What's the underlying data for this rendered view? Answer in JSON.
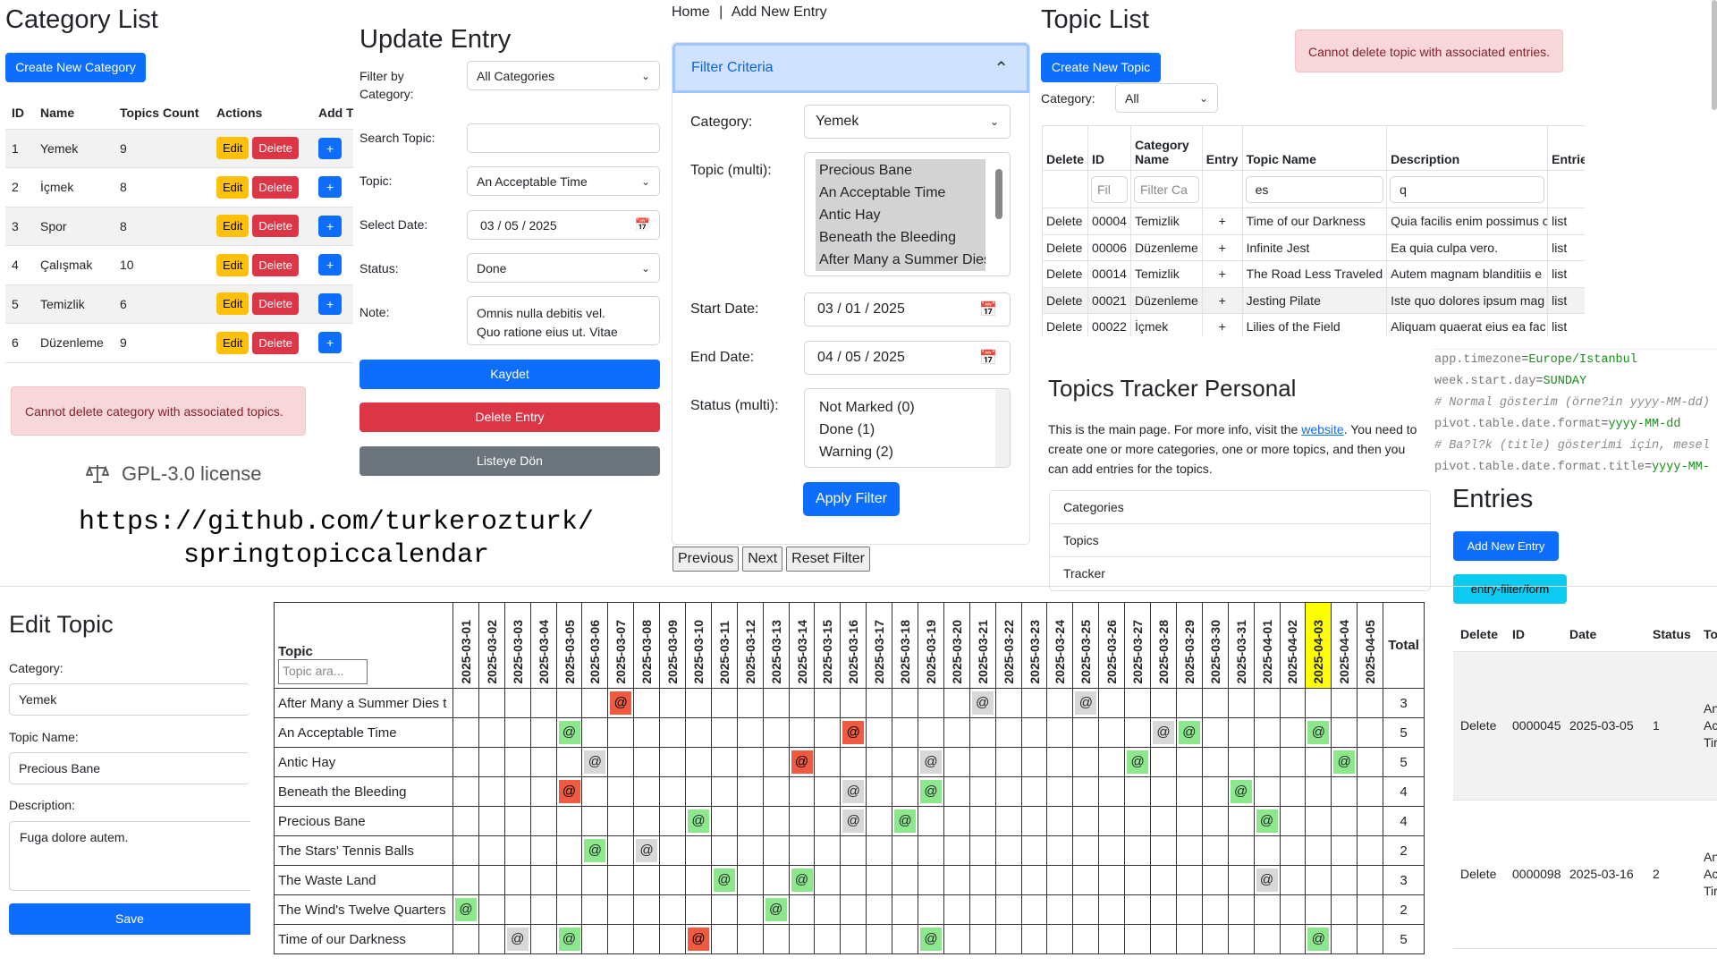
{
  "category_list": {
    "title": "Category List",
    "create_btn": "Create New Category",
    "headers": [
      "ID",
      "Name",
      "Topics Count",
      "Actions",
      "Add T"
    ],
    "rows": [
      {
        "id": "1",
        "name": "Yemek",
        "count": "9"
      },
      {
        "id": "2",
        "name": "İçmek",
        "count": "8"
      },
      {
        "id": "3",
        "name": "Spor",
        "count": "8"
      },
      {
        "id": "4",
        "name": "Çalışmak",
        "count": "10"
      },
      {
        "id": "5",
        "name": "Temizlik",
        "count": "6"
      },
      {
        "id": "6",
        "name": "Düzenleme",
        "count": "9"
      }
    ],
    "edit_label": "Edit",
    "delete_label": "Delete",
    "add_label": "+",
    "alert": "Cannot delete category with associated topics."
  },
  "license": {
    "icon": "scale-icon",
    "text": "GPL-3.0 license"
  },
  "repo_url_line1": "https://github.com/turkerozturk/",
  "repo_url_line2": "springtopiccalendar",
  "update_entry": {
    "title": "Update Entry",
    "filter_label": "Filter by Category:",
    "filter_value": "All Categories",
    "search_label": "Search Topic:",
    "search_value": "",
    "topic_label": "Topic:",
    "topic_value": "An Acceptable Time",
    "date_label": "Select Date:",
    "date_value": "03 / 05 / 2025",
    "status_label": "Status:",
    "status_value": "Done",
    "note_label": "Note:",
    "note_line1": "Omnis nulla debitis vel.",
    "note_line2": "Quo ratione eius ut. Vitae",
    "save_btn": "Kaydet",
    "delete_btn": "Delete Entry",
    "back_btn": "Listeye Dön"
  },
  "breadcrumb": {
    "home": "Home",
    "sep": "|",
    "current": "Add New Entry"
  },
  "filter": {
    "header": "Filter Criteria",
    "category_label": "Category:",
    "category_value": "Yemek",
    "topic_label": "Topic (multi):",
    "topics": [
      "Precious Bane",
      "An Acceptable Time",
      "Antic Hay",
      "Beneath the Bleeding",
      "After Many a Summer Dies t"
    ],
    "start_label": "Start Date:",
    "start_value": "03 / 01 / 2025",
    "end_label": "End Date:",
    "end_value": "04 / 05 / 2025",
    "status_label": "Status (multi):",
    "statuses": [
      "Not Marked (0)",
      "Done (1)",
      "Warning (2)"
    ],
    "apply_btn": "Apply Filter",
    "prev_btn": "Previous",
    "next_btn": "Next",
    "reset_btn": "Reset Filter"
  },
  "topic_list": {
    "title": "Topic List",
    "create_btn": "Create New Topic",
    "alert": "Cannot delete topic with associated entries.",
    "category_label": "Category:",
    "category_value": "All",
    "headers": [
      "Delete",
      "ID",
      "Category Name",
      "Entry",
      "Topic Name",
      "Description",
      "Entries"
    ],
    "filter_id": "Fil",
    "filter_cat": "Filter Ca",
    "filter_name": "es",
    "filter_desc": "q",
    "rows": [
      {
        "del": "Delete",
        "id": "00004",
        "cat": "Temizlik",
        "entry": "+",
        "name": "Time of our Darkness",
        "desc": "Quia facilis enim possimus c",
        "entries": "list"
      },
      {
        "del": "Delete",
        "id": "00006",
        "cat": "Düzenleme",
        "entry": "+",
        "name": "Infinite Jest",
        "desc": "Ea quia culpa vero.",
        "entries": "list"
      },
      {
        "del": "Delete",
        "id": "00014",
        "cat": "Temizlik",
        "entry": "+",
        "name": "The Road Less Traveled",
        "desc": "Autem magnam blanditiis e",
        "entries": "list"
      },
      {
        "del": "Delete",
        "id": "00021",
        "cat": "Düzenleme",
        "entry": "+",
        "name": "Jesting Pilate",
        "desc": "Iste quo dolores ipsum mag",
        "entries": "list"
      },
      {
        "del": "Delete",
        "id": "00022",
        "cat": "İçmek",
        "entry": "+",
        "name": "Lilies of the Field",
        "desc": "Aliquam quaerat eius ea fac",
        "entries": "list"
      }
    ]
  },
  "tracker": {
    "title": "Topics Tracker Personal",
    "text_before": "This is the main page. For more info, visit the ",
    "link": "website",
    "text_after": ". You need to create one or more categories, one or more topics, and then you can add entries for the topics.",
    "items": [
      "Categories",
      "Topics",
      "Tracker"
    ]
  },
  "config": [
    {
      "key": "app.timezone",
      "value": "Europe/Istanbul"
    },
    {
      "key": "week.start.day",
      "value": "SUNDAY"
    },
    {
      "comment": "# Normal gösterim (örne?in yyyy-MM-dd)"
    },
    {
      "key": "pivot.table.date.format",
      "value": "yyyy-MM-dd"
    },
    {
      "comment": "# Ba?l?k (title) gösterimi için, mesel"
    },
    {
      "key": "pivot.table.date.format.title",
      "value": "yyyy-MM-"
    }
  ],
  "entries": {
    "title": "Entries",
    "add_btn": "Add New Entry",
    "filter_btn": "entry-filter/form",
    "headers": [
      "Delete",
      "ID",
      "Date",
      "Status",
      "To"
    ],
    "rows": [
      {
        "del": "Delete",
        "id": "0000045",
        "date": "2025-03-05",
        "status": "1",
        "topic1": "An",
        "topic2": "Ac",
        "topic3": "Tir"
      },
      {
        "del": "Delete",
        "id": "0000098",
        "date": "2025-03-16",
        "status": "2",
        "topic1": "An",
        "topic2": "Ac",
        "topic3": "Tir"
      }
    ]
  },
  "edit_topic": {
    "title": "Edit Topic",
    "category_label": "Category:",
    "category_value": "Yemek",
    "name_label": "Topic Name:",
    "name_value": "Precious Bane",
    "desc_label": "Description:",
    "desc_value": "Fuga dolore autem.",
    "save_btn": "Save"
  },
  "calendar": {
    "topic_header": "Topic",
    "search_placeholder": "Topic ara...",
    "total_header": "Total",
    "highlight_date": "2025-04-03",
    "dates": [
      "2025-03-01",
      "2025-03-02",
      "2025-03-03",
      "2025-03-04",
      "2025-03-05",
      "2025-03-06",
      "2025-03-07",
      "2025-03-08",
      "2025-03-09",
      "2025-03-10",
      "2025-03-11",
      "2025-03-12",
      "2025-03-13",
      "2025-03-14",
      "2025-03-15",
      "2025-03-16",
      "2025-03-17",
      "2025-03-18",
      "2025-03-19",
      "2025-03-20",
      "2025-03-21",
      "2025-03-22",
      "2025-03-23",
      "2025-03-24",
      "2025-03-25",
      "2025-03-26",
      "2025-03-27",
      "2025-03-28",
      "2025-03-29",
      "2025-03-30",
      "2025-03-31",
      "2025-04-01",
      "2025-04-02",
      "2025-04-03",
      "2025-04-04",
      "2025-04-05"
    ],
    "mark": "@",
    "colors": {
      "g": "#8de88d",
      "r": "#f05a40",
      "y": "#d8d8d8"
    },
    "rows": [
      {
        "topic": "After Many a Summer Dies t",
        "total": "3",
        "marks": {
          "6": "r",
          "20": "y",
          "24": "y"
        }
      },
      {
        "topic": "An Acceptable Time",
        "total": "5",
        "marks": {
          "4": "g",
          "15": "r",
          "27": "y",
          "28": "g",
          "33": "g"
        }
      },
      {
        "topic": "Antic Hay",
        "total": "5",
        "marks": {
          "5": "y",
          "13": "r",
          "18": "y",
          "26": "g",
          "34": "g"
        }
      },
      {
        "topic": "Beneath the Bleeding",
        "total": "4",
        "marks": {
          "4": "r",
          "15": "y",
          "18": "g",
          "30": "g"
        }
      },
      {
        "topic": "Precious Bane",
        "total": "4",
        "marks": {
          "9": "g",
          "15": "y",
          "17": "g",
          "31": "g"
        }
      },
      {
        "topic": "The Stars' Tennis Balls",
        "total": "2",
        "marks": {
          "5": "g",
          "7": "y"
        }
      },
      {
        "topic": "The Waste Land",
        "total": "3",
        "marks": {
          "10": "g",
          "13": "g",
          "31": "y"
        }
      },
      {
        "topic": "The Wind's Twelve Quarters",
        "total": "2",
        "marks": {
          "0": "g",
          "12": "g"
        }
      },
      {
        "topic": "Time of our Darkness",
        "total": "5",
        "marks": {
          "2": "y",
          "4": "g",
          "9": "r",
          "18": "g",
          "33": "g"
        }
      }
    ]
  }
}
